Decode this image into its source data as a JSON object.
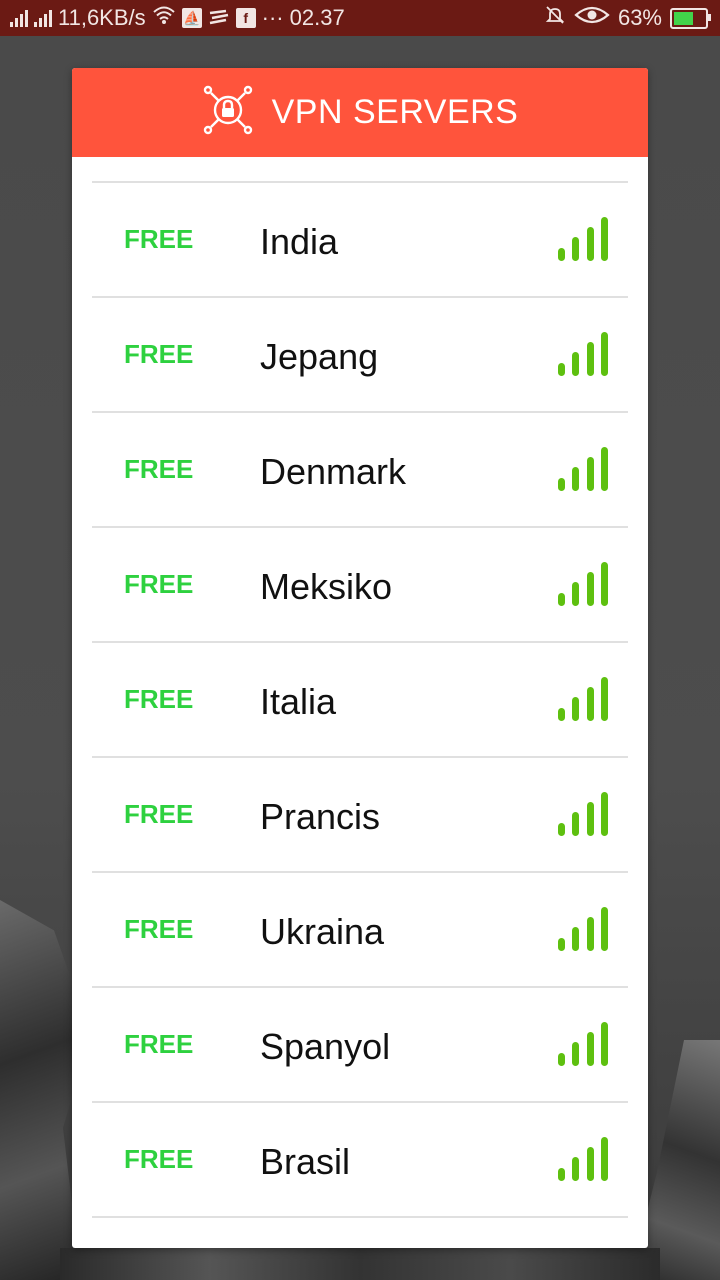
{
  "status_bar": {
    "network_speed": "11,6KB/s",
    "more": "···",
    "time": "02.37",
    "battery": "63%",
    "battery_level": 0.63
  },
  "header": {
    "title": "VPN SERVERS",
    "icon": "network-lock-icon",
    "color": "#ff543c"
  },
  "colors": {
    "free": "#2ed13f",
    "signal": "#5ec010"
  },
  "servers": [
    {
      "tier": "FREE",
      "country": "India",
      "signal": "signal-strength-icon"
    },
    {
      "tier": "FREE",
      "country": "Jepang",
      "signal": "signal-strength-icon"
    },
    {
      "tier": "FREE",
      "country": "Denmark",
      "signal": "signal-strength-icon"
    },
    {
      "tier": "FREE",
      "country": "Meksiko",
      "signal": "signal-strength-icon"
    },
    {
      "tier": "FREE",
      "country": "Italia",
      "signal": "signal-strength-icon"
    },
    {
      "tier": "FREE",
      "country": "Prancis",
      "signal": "signal-strength-icon"
    },
    {
      "tier": "FREE",
      "country": "Ukraina",
      "signal": "signal-strength-icon"
    },
    {
      "tier": "FREE",
      "country": "Spanyol",
      "signal": "signal-strength-icon"
    },
    {
      "tier": "FREE",
      "country": "Brasil",
      "signal": "signal-strength-icon"
    }
  ]
}
